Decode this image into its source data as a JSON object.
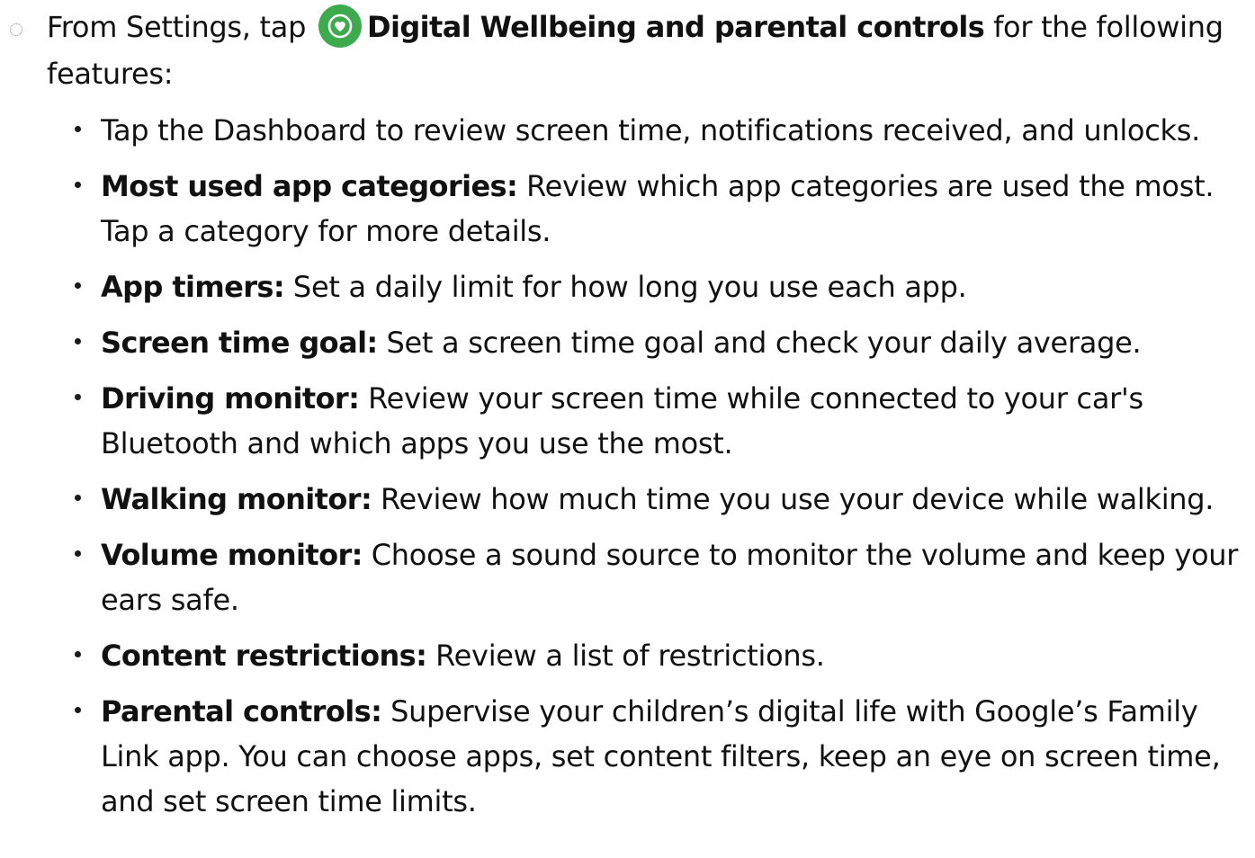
{
  "intro": {
    "prefix": "From Settings, tap ",
    "app_name": "Digital Wellbeing and parental controls",
    "suffix": " for the following features:",
    "icon": "digital-wellbeing-heart-icon",
    "icon_color": "#3dab4d"
  },
  "features": [
    {
      "label": "",
      "text": "Tap the Dashboard to review screen time, notifications received, and unlocks."
    },
    {
      "label": "Most used app categories:",
      "text": " Review which app categories are used the most. Tap a category for more details."
    },
    {
      "label": "App timers:",
      "text": " Set a daily limit for how long you use each app."
    },
    {
      "label": "Screen time goal:",
      "text": " Set a screen time goal and check your daily average."
    },
    {
      "label": "Driving monitor:",
      "text": " Review your screen time while connected to your car's Bluetooth and which apps you use the most."
    },
    {
      "label": "Walking monitor:",
      "text": " Review how much time you use your device while walking."
    },
    {
      "label": "Volume monitor:",
      "text": " Choose a sound source to monitor the volume and keep your ears safe."
    },
    {
      "label": "Content restrictions:",
      "text": " Review a list of restrictions."
    },
    {
      "label": "Parental controls:",
      "text": " Supervise your children’s digital life with Google’s Family Link app. You can choose apps, set content filters, keep an eye on screen time, and set screen time limits."
    }
  ]
}
